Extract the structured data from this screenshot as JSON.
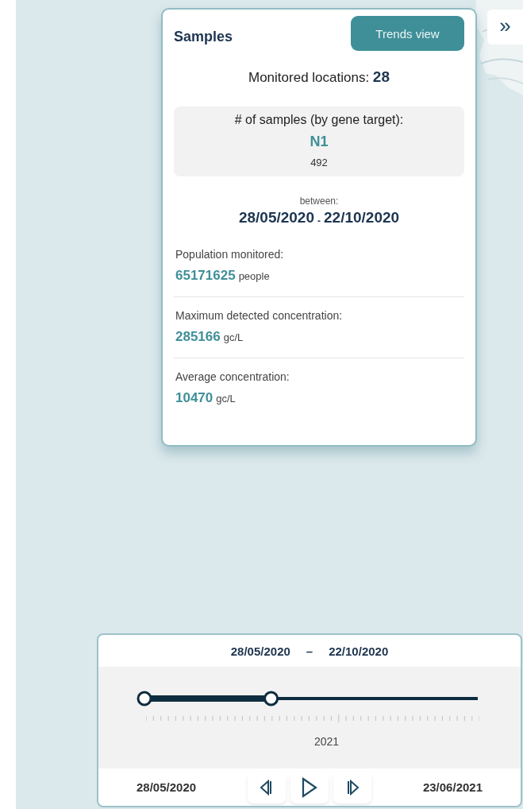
{
  "collapse_button": {
    "label": "»"
  },
  "samples_panel": {
    "title": "Samples",
    "trends_button": "Trends view",
    "monitored_locations": {
      "label": "Monitored locations:",
      "value": "28"
    },
    "samples_by_gene": {
      "heading": "# of samples (by gene target):",
      "target": "N1",
      "count": "492"
    },
    "between": {
      "label": "between:",
      "start": "28/05/2020",
      "separator": "-",
      "end": "22/10/2020"
    },
    "stats": [
      {
        "label": "Population monitored:",
        "value": "65171625",
        "unit": "people"
      },
      {
        "label": "Maximum detected concentration:",
        "value": "285166",
        "unit": "gc/L"
      },
      {
        "label": "Average concentration:",
        "value": "10470",
        "unit": "gc/L"
      }
    ]
  },
  "timeline": {
    "range_start": "28/05/2020",
    "range_separator": "–",
    "range_end": "22/10/2020",
    "handles": [
      {
        "level": 0
      },
      {
        "level": 0.38
      }
    ],
    "axis_label": "2021",
    "min_date": "28/05/2020",
    "max_date": "23/06/2021",
    "controls": [
      {
        "kind": "step-back"
      },
      {
        "kind": "play"
      },
      {
        "kind": "step-forward"
      }
    ]
  }
}
